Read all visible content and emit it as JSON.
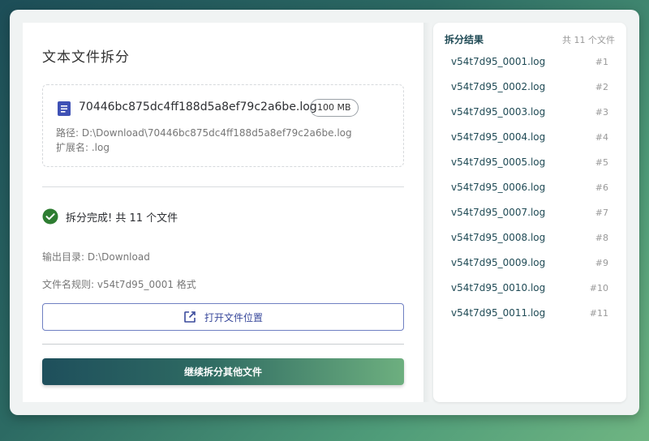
{
  "page_title": "文本文件拆分",
  "file": {
    "name": "70446bc875dc4ff188d5a8ef79c2a6be.log",
    "size": "100 MB",
    "path": "路径: D:\\Download\\70446bc875dc4ff188d5a8ef79c2a6be.log",
    "extension": "扩展名: .log"
  },
  "status": {
    "text": "拆分完成! 共 11 个文件",
    "output_dir": "输出目录: D:\\Download",
    "naming_rule": "文件名规则: v54t7d95_0001 格式"
  },
  "buttons": {
    "open_location": "打开文件位置",
    "continue_split": "继续拆分其他文件"
  },
  "results": {
    "title": "拆分结果",
    "count": "共 11 个文件",
    "items": [
      {
        "name": "v54t7d95_0001.log",
        "index": "#1"
      },
      {
        "name": "v54t7d95_0002.log",
        "index": "#2"
      },
      {
        "name": "v54t7d95_0003.log",
        "index": "#3"
      },
      {
        "name": "v54t7d95_0004.log",
        "index": "#4"
      },
      {
        "name": "v54t7d95_0005.log",
        "index": "#5"
      },
      {
        "name": "v54t7d95_0006.log",
        "index": "#6"
      },
      {
        "name": "v54t7d95_0007.log",
        "index": "#7"
      },
      {
        "name": "v54t7d95_0008.log",
        "index": "#8"
      },
      {
        "name": "v54t7d95_0009.log",
        "index": "#9"
      },
      {
        "name": "v54t7d95_0010.log",
        "index": "#10"
      },
      {
        "name": "v54t7d95_0011.log",
        "index": "#11"
      }
    ]
  },
  "icons": {
    "file": "document-icon",
    "status": "check-circle-icon",
    "open_location": "open-external-icon"
  },
  "colors": {
    "accent": "#1f4a55",
    "success": "#2e7d32",
    "outline_button": "#6f7fc2",
    "file_icon": "#3f51b5"
  }
}
